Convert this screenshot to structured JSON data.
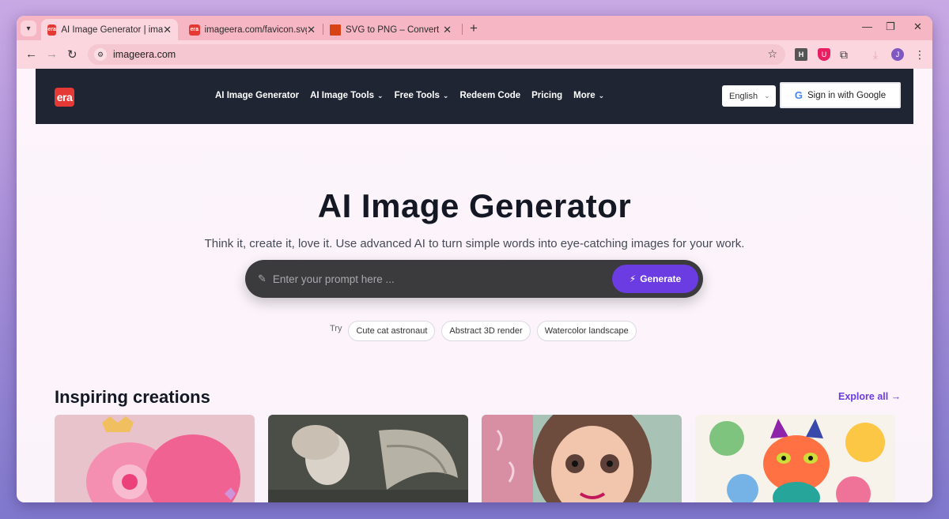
{
  "browser": {
    "tabs": [
      {
        "title": "AI Image Generator | imageera",
        "favicon": "era"
      },
      {
        "title": "imageera.com/favicon.svg",
        "favicon": "era"
      },
      {
        "title": "SVG to PNG – Convert SVG files",
        "favicon": "svg-to-png-icon"
      }
    ],
    "new_tab": "+",
    "address": "imageera.com",
    "avatar_letter": "J",
    "ext_h": "H"
  },
  "site": {
    "logo": "era",
    "nav": [
      {
        "label": "AI Image Generator"
      },
      {
        "label": "AI Image Tools",
        "dropdown": true
      },
      {
        "label": "Free Tools",
        "dropdown": true
      },
      {
        "label": "Redeem Code"
      },
      {
        "label": "Pricing"
      },
      {
        "label": "More",
        "dropdown": true
      }
    ],
    "language": "English",
    "signin_label": "Sign in with Google"
  },
  "hero": {
    "title": "AI Image Generator",
    "subtitle": "Think it, create it, love it. Use advanced AI to turn simple words into eye-catching images for your work.",
    "prompt_placeholder": "Enter your prompt here ...",
    "generate_label": "Generate",
    "try_label": "Try",
    "suggestions": [
      "Cute cat astronaut",
      "Abstract 3D render",
      "Watercolor landscape"
    ]
  },
  "gallery": {
    "title": "Inspiring creations",
    "explore_label": "Explore all"
  },
  "colors": {
    "accent": "#6c3ce3",
    "nav_bg": "#1f2533",
    "brand_red": "#e53935",
    "tab_strip": "#f6b6c4"
  }
}
